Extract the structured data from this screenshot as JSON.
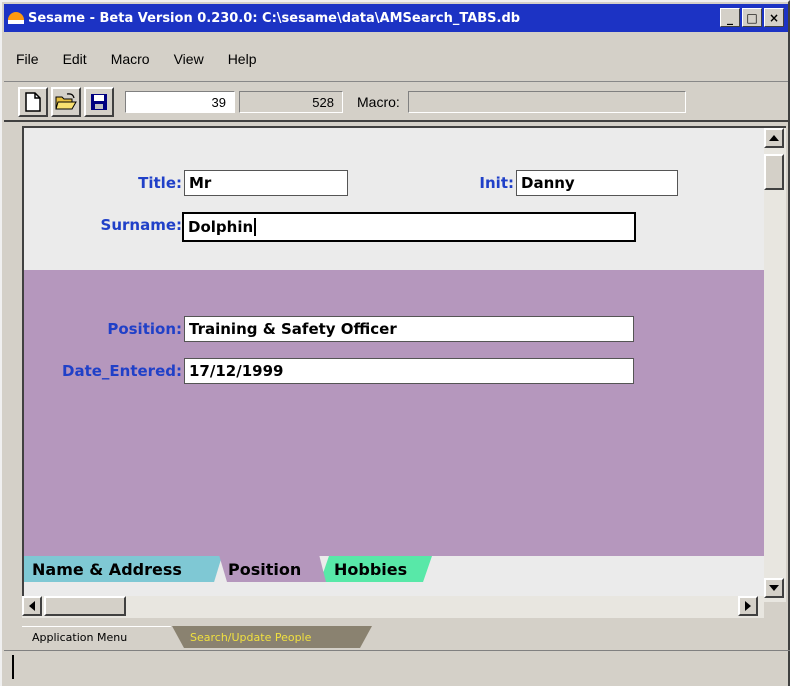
{
  "window": {
    "title": "Sesame - Beta Version 0.230.0: C:\\sesame\\data\\AMSearch_TABS.db",
    "btn_minimize": "_",
    "btn_maximize": "□",
    "btn_close": "×"
  },
  "menu": {
    "file": "File",
    "edit": "Edit",
    "macro": "Macro",
    "view": "View",
    "help": "Help"
  },
  "toolbar": {
    "record_number": "39",
    "record_count": "528",
    "macro_label": "Macro:",
    "macro_value": ""
  },
  "form": {
    "title_label": "Title:",
    "title_value": "Mr",
    "init_label": "Init:",
    "init_value": "Danny",
    "surname_label": "Surname:",
    "surname_value": "Dolphin",
    "position_label": "Position:",
    "position_value": "Training & Safety Officer",
    "date_label": "Date_Entered:",
    "date_value": "17/12/1999"
  },
  "tabs": [
    {
      "label": "Name & Address"
    },
    {
      "label": "Position"
    },
    {
      "label": "Hobbies"
    }
  ],
  "app_tabs": [
    {
      "label": "Application Menu"
    },
    {
      "label": "Search/Update People"
    }
  ],
  "colors": {
    "titlebar": "#1c33c4",
    "field_label": "#2040c8",
    "panel_purple": "#b597bd",
    "tab_name_address": "#7fc8d4",
    "tab_hobbies": "#58e8a8",
    "app_tab_active_text": "#f0e040"
  },
  "icons": [
    "app-icon",
    "new-document-icon",
    "open-folder-icon",
    "save-disk-icon",
    "scroll-up-icon",
    "scroll-down-icon",
    "scroll-left-icon",
    "scroll-right-icon"
  ]
}
